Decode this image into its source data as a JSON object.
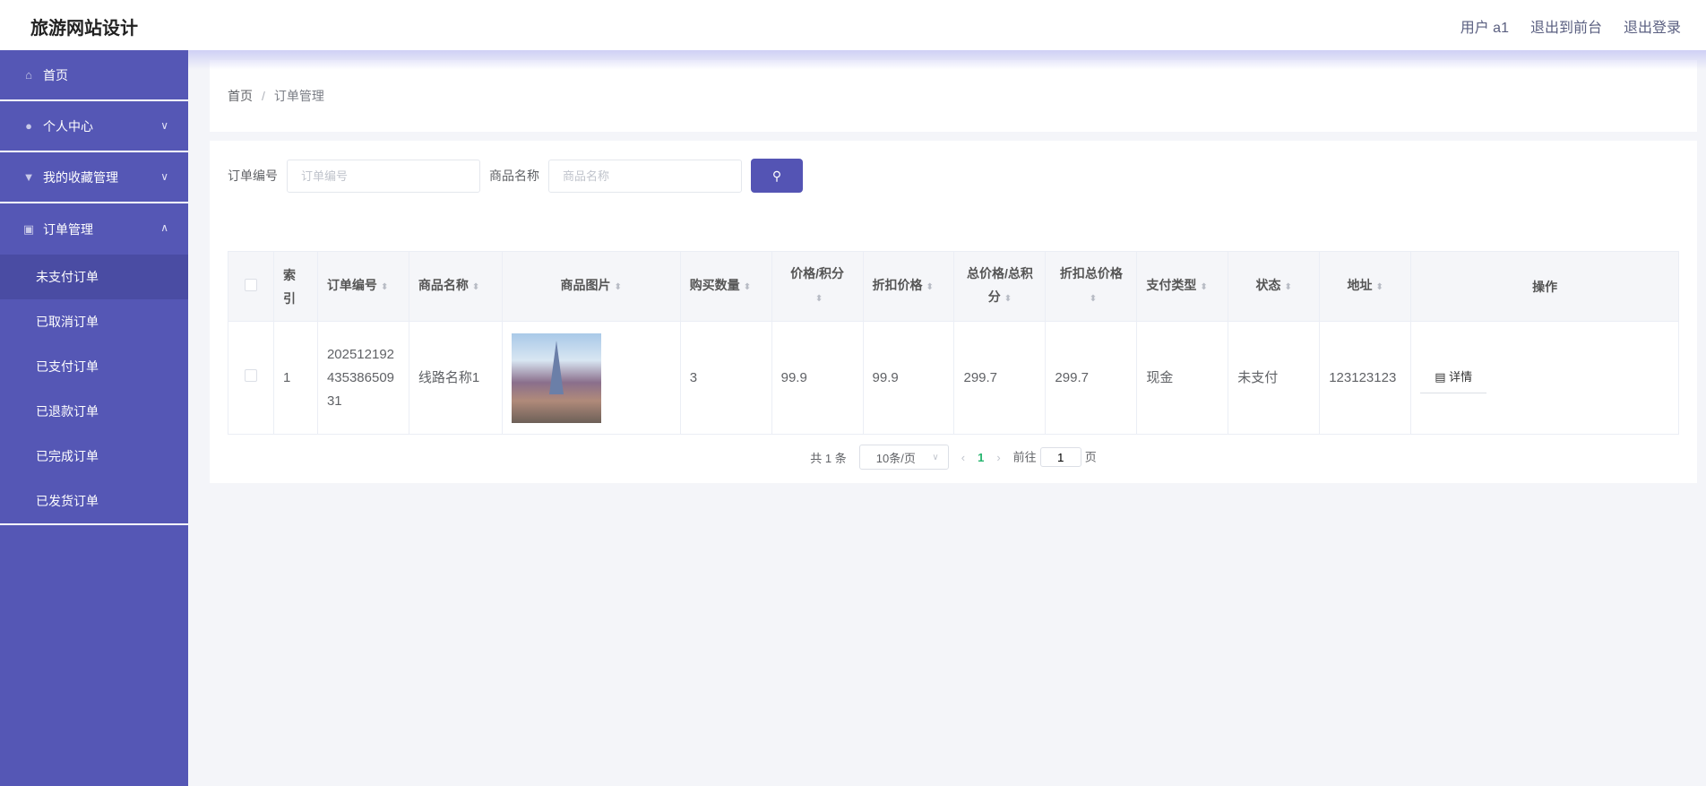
{
  "header": {
    "title": "旅游网站设计",
    "user": "用户 a1",
    "to_front": "退出到前台",
    "logout": "退出登录"
  },
  "sidebar": {
    "items": [
      {
        "label": "首页",
        "icon": "home-icon"
      },
      {
        "label": "个人中心",
        "icon": "user-icon"
      },
      {
        "label": "我的收藏管理",
        "icon": "bookmark-icon"
      },
      {
        "label": "订单管理",
        "icon": "order-icon"
      }
    ],
    "sub_items": [
      "未支付订单",
      "已取消订单",
      "已支付订单",
      "已退款订单",
      "已完成订单",
      "已发货订单"
    ]
  },
  "breadcrumb": {
    "home": "首页",
    "sep": "/",
    "current": "订单管理"
  },
  "search": {
    "order_label": "订单编号",
    "order_placeholder": "订单编号",
    "product_label": "商品名称",
    "product_placeholder": "商品名称"
  },
  "table": {
    "headers": [
      "索引",
      "订单编号",
      "商品名称",
      "商品图片",
      "购买数量",
      "价格/积分",
      "折扣价格",
      "总价格/总积分",
      "折扣总价格",
      "支付类型",
      "状态",
      "地址",
      "操作"
    ],
    "rows": [
      {
        "index": "1",
        "order_no": "20251219243538650931",
        "name": "线路名称1",
        "qty": "3",
        "price": "99.9",
        "discount": "99.9",
        "total": "299.7",
        "discount_total": "299.7",
        "pay_type": "现金",
        "status": "未支付",
        "address": "123123123",
        "action": "详情"
      }
    ]
  },
  "pagination": {
    "total": "共 1 条",
    "page_size": "10条/页",
    "current": "1",
    "goto_label": "前往",
    "goto_value": "1",
    "page_suffix": "页"
  },
  "colors": {
    "sidebar": "#5557b5",
    "accent": "#5454b4",
    "active_page": "#26b56f"
  }
}
